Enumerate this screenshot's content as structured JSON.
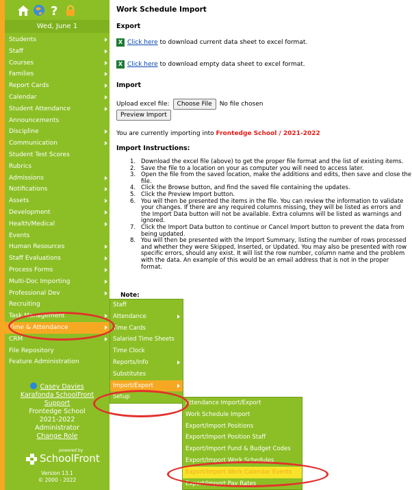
{
  "sidebar": {
    "date": "Wed, June 1",
    "items": [
      {
        "label": "Students",
        "arrow": true
      },
      {
        "label": "Staff",
        "arrow": true
      },
      {
        "label": "Courses",
        "arrow": true
      },
      {
        "label": "Families",
        "arrow": true
      },
      {
        "label": "Report Cards",
        "arrow": true
      },
      {
        "label": "Calendar",
        "arrow": true
      },
      {
        "label": "Student Attendance",
        "arrow": true
      },
      {
        "label": "Announcements",
        "arrow": false
      },
      {
        "label": "Discipline",
        "arrow": true
      },
      {
        "label": "Communication",
        "arrow": true
      },
      {
        "label": "Student Test Scores",
        "arrow": false
      },
      {
        "label": "Rubrics",
        "arrow": false
      },
      {
        "label": "Admissions",
        "arrow": true
      },
      {
        "label": "Notifications",
        "arrow": true
      },
      {
        "label": "Assets",
        "arrow": true
      },
      {
        "label": "Development",
        "arrow": true
      },
      {
        "label": "Health/Medical",
        "arrow": true
      },
      {
        "label": "Events",
        "arrow": false
      },
      {
        "label": "Human Resources",
        "arrow": true
      },
      {
        "label": "Staff Evaluations",
        "arrow": true
      },
      {
        "label": "Process Forms",
        "arrow": true
      },
      {
        "label": "Multi-Doc Importing",
        "arrow": true
      },
      {
        "label": "Professional Dev",
        "arrow": true
      },
      {
        "label": "Recruiting",
        "arrow": false
      },
      {
        "label": "Task Management",
        "arrow": true
      },
      {
        "label": "Time & Attendance",
        "arrow": true,
        "selected": true
      },
      {
        "label": "CRM",
        "arrow": true
      },
      {
        "label": "File Repository",
        "arrow": false
      },
      {
        "label": "Feature Administration",
        "arrow": false
      }
    ],
    "user_name": "Casey Davies",
    "support_link": "Karafonda SchoolFront Support",
    "school": "Frontedge School",
    "year": "2021-2022",
    "role": "Administrator",
    "change_role": "Change Role",
    "logo_powered": "powered by",
    "logo_text": "SchoolFront",
    "version": "Version 13.1",
    "copyright": "© 2000 - 2022"
  },
  "main": {
    "title": "Work Schedule Import",
    "export_heading": "Export",
    "download_current_link": "Click here",
    "download_current_text": " to download current data sheet to excel format.",
    "download_empty_link": "Click here",
    "download_empty_text": " to download empty data sheet to excel format.",
    "import_heading": "Import",
    "upload_label": "Upload excel file:",
    "choose_file": "Choose File",
    "no_file": "No file chosen",
    "preview_button": "Preview Import",
    "importing_prefix": "You are currently importing into ",
    "importing_target": "Frontedge School / 2021-2022",
    "instructions_heading": "Import Instructions:",
    "notes_partial": "Note:",
    "steps": [
      "Download the excel file (above) to get the proper file format and the list of existing items.",
      "Save the file to a location on your as computer you will need to access later.",
      "Open the file from the saved location, make the additions and edits, then save and close the file.",
      "Click the Browse button, and find the saved file containing the updates.",
      "Click the Preview Import button.",
      "You will then be presented the items in the file. You can review the information to validate your changes. If there are any required columns missing, they will be listed as errors and the Import Data button will not be available. Extra columns will be listed as warnings and ignored.",
      "Click the Import Data button to continue or Cancel Import button to prevent the data from being updated.",
      "You will then be presented with the Import Summary, listing the number of rows processed and whether they were Skipped, Inserted, or Updated. You may also be presented with row specific errors, should any exist. It will list the row number, column name and the problem with the data. An example of this would be an email address that is not in the proper format."
    ]
  },
  "flyout_time": [
    {
      "label": "Staff",
      "arrow": false
    },
    {
      "label": "Attendance",
      "arrow": true
    },
    {
      "label": "Time Cards",
      "arrow": false
    },
    {
      "label": "Salaried Time Sheets",
      "arrow": false
    },
    {
      "label": "Time Clock",
      "arrow": false
    },
    {
      "label": "Reports/Info",
      "arrow": true
    },
    {
      "label": "Substitutes",
      "arrow": false
    },
    {
      "label": "Import/Export",
      "arrow": true,
      "selected": true
    },
    {
      "label": "Setup",
      "arrow": false
    }
  ],
  "flyout_import": [
    {
      "label": "Attendance Import/Export"
    },
    {
      "label": "Work Schedule Import"
    },
    {
      "label": "Export/Import Positions"
    },
    {
      "label": "Export/Import Position Staff"
    },
    {
      "label": "Export/Import Fund & Budget Codes"
    },
    {
      "label": "Export/Import Work Schedules"
    },
    {
      "label": "Export/Import Work Calendar Events",
      "hot": true
    },
    {
      "label": "Export/Import Pay Rates"
    }
  ],
  "colors": {
    "sidebar_green": "#8cbf26",
    "accent_orange": "#f7a823",
    "highlight_red": "#e41b17",
    "annotation_red": "#e2312b"
  }
}
